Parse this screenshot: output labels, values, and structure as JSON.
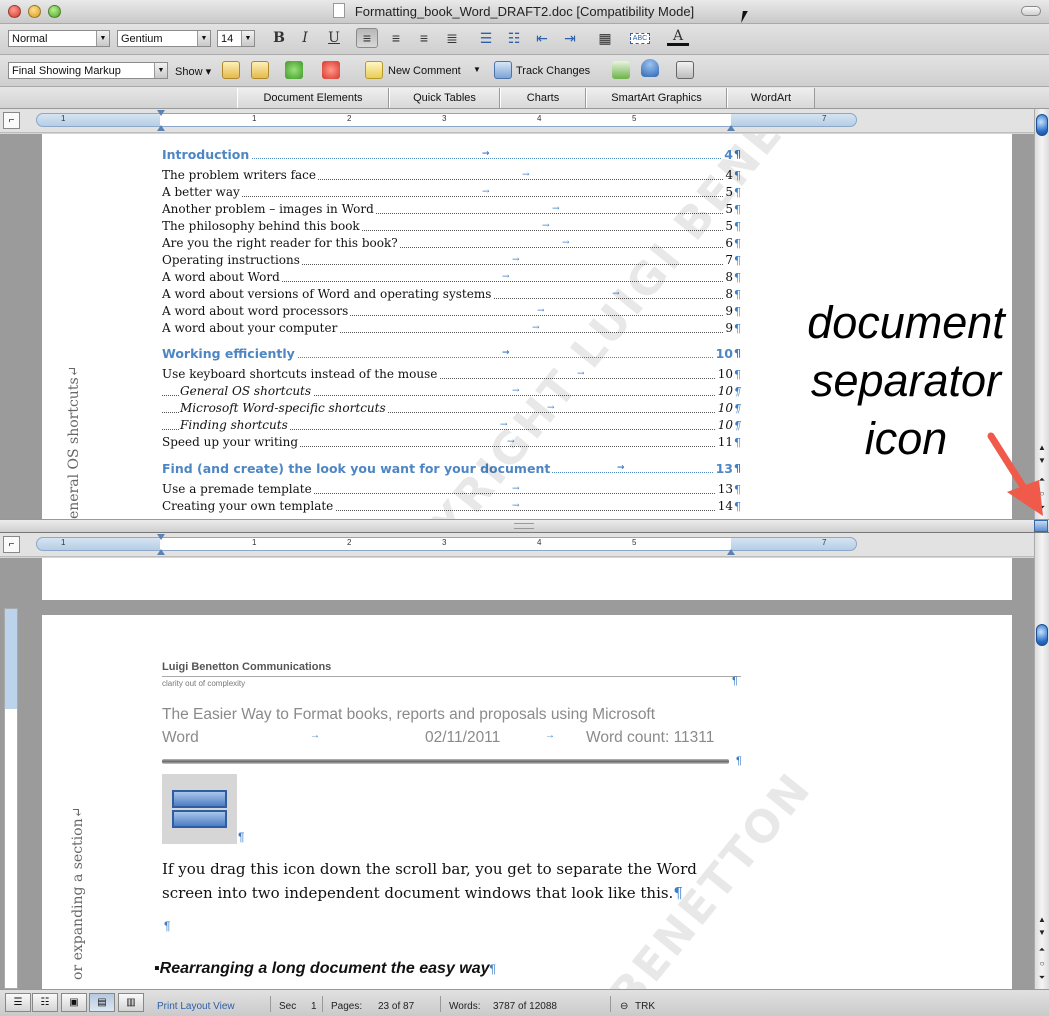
{
  "window": {
    "title": "Formatting_book_Word_DRAFT2.doc [Compatibility Mode]"
  },
  "toolbar": {
    "style_value": "Normal",
    "font_value": "Gentium",
    "size_value": "14",
    "bold": "B",
    "italic": "I",
    "underline": "U",
    "markup_value": "Final Showing Markup",
    "show_label": "Show",
    "new_comment_label": "New Comment",
    "track_changes_label": "Track Changes"
  },
  "ribbon": {
    "tabs": [
      "Document Elements",
      "Quick Tables",
      "Charts",
      "SmartArt Graphics",
      "WordArt"
    ]
  },
  "ruler": {
    "numbers": [
      "1",
      "1",
      "2",
      "3",
      "4",
      "5",
      "6",
      "7"
    ]
  },
  "top_pane": {
    "side_text": "d this book if... || General OS shortcuts↵",
    "toc": [
      {
        "label": "Introduction",
        "page": "4",
        "heading": true
      },
      {
        "label": "The problem writers face",
        "page": "4"
      },
      {
        "label": "A better way",
        "page": "5"
      },
      {
        "label": "Another problem – images in Word",
        "page": "5"
      },
      {
        "label": "The philosophy behind this book",
        "page": "5"
      },
      {
        "label": "Are you the right reader for this book?",
        "page": "6"
      },
      {
        "label": "Operating instructions",
        "page": "7"
      },
      {
        "label": "A word about Word",
        "page": "8"
      },
      {
        "label": "A word about versions of Word and operating systems",
        "page": "8"
      },
      {
        "label": "A word about word processors",
        "page": "9"
      },
      {
        "label": "A word about your computer",
        "page": "9"
      },
      {
        "label": "Working efficiently",
        "page": "10",
        "heading": true
      },
      {
        "label": "Use keyboard shortcuts instead of the mouse",
        "page": "10"
      },
      {
        "label": "General OS shortcuts",
        "page": "10",
        "sub": true
      },
      {
        "label": "Microsoft Word-specific shortcuts",
        "page": "10",
        "sub": true
      },
      {
        "label": "Finding shortcuts",
        "page": "10",
        "sub": true
      },
      {
        "label": "Speed up your writing",
        "page": "11"
      },
      {
        "label": "Find (and create) the look you want for your document",
        "page": "13",
        "heading": true
      },
      {
        "label": "Use a premade template",
        "page": "13"
      },
      {
        "label": "Creating your own template",
        "page": "14"
      }
    ],
    "watermark": "COPYRIGHT LUIGI BENETTON"
  },
  "annotation": {
    "line1": "document",
    "line2": "separator",
    "line3": "icon"
  },
  "bottom_pane": {
    "side_text": "or expanding a section↵",
    "header_company": "Luigi Benetton Communications",
    "header_tagline": "clarity out of complexity",
    "doc_title_line1": "The Easier Way to Format books, reports and proposals using Microsoft",
    "doc_title_line2": "Word",
    "doc_date": "02/11/2011",
    "doc_wordcount": "Word count: 11311",
    "body_line1": "If you drag this icon down the scroll bar, you get to separate the Word",
    "body_line2": "screen into two independent document windows that look like this.",
    "heading": "Rearranging a long document the easy way",
    "watermark": "BENETTON"
  },
  "statusbar": {
    "view": "Print Layout View",
    "sec_label": "Sec",
    "sec_value": "1",
    "pages_label": "Pages:",
    "pages_value": "23 of 87",
    "words_label": "Words:",
    "words_value": "3787 of 12088",
    "trk": "TRK"
  },
  "colors": {
    "accent_blue": "#4e86c4",
    "pilcrow": "#3d7ec7",
    "arrow_red": "#f05a4a"
  },
  "icons": [
    "close-icon",
    "minimize-icon",
    "zoom-icon",
    "document-icon",
    "cursor-icon",
    "bold-icon",
    "italic-icon",
    "underline-icon",
    "align-left-icon",
    "align-center-icon",
    "align-right-icon",
    "justify-icon",
    "numbered-list-icon",
    "bulleted-list-icon",
    "outdent-icon",
    "indent-icon",
    "borders-icon",
    "highlight-icon",
    "font-color-icon",
    "accept-change-icon",
    "reject-change-icon",
    "new-comment-icon",
    "track-changes-icon",
    "document-separator-icon",
    "arrow-icon"
  ]
}
